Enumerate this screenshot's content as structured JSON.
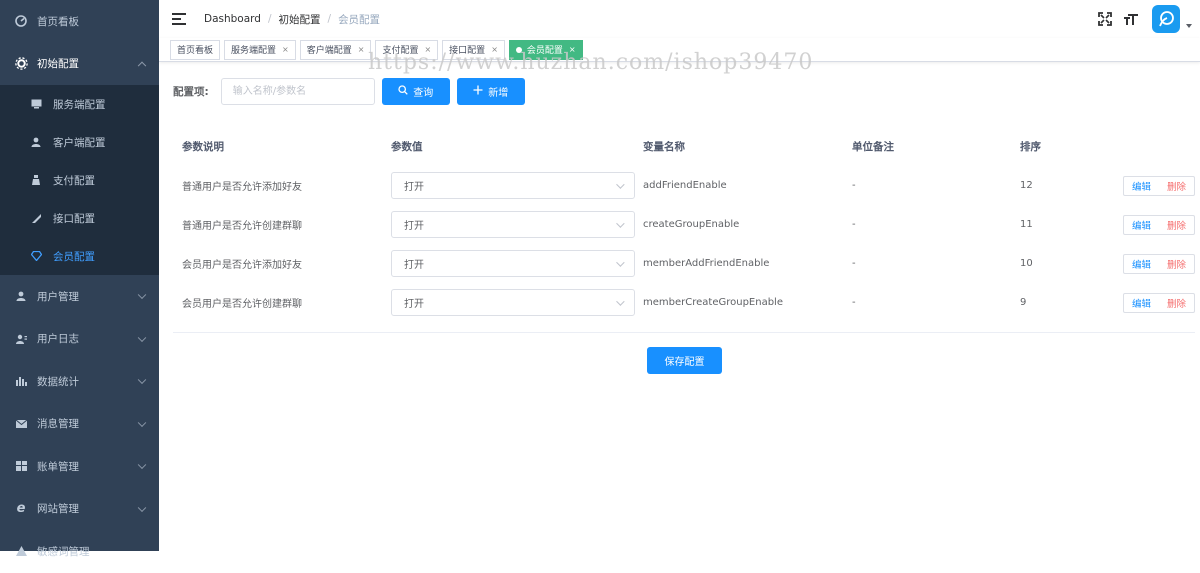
{
  "sidebar": {
    "items": [
      {
        "label": "首页看板",
        "icon": "dashboard-icon"
      },
      {
        "label": "初始配置",
        "icon": "settings-icon",
        "open": true,
        "children": [
          {
            "label": "服务端配置",
            "icon": "monitor-icon"
          },
          {
            "label": "客户端配置",
            "icon": "user-icon"
          },
          {
            "label": "支付配置",
            "icon": "payment-icon"
          },
          {
            "label": "接口配置",
            "icon": "plug-icon"
          },
          {
            "label": "会员配置",
            "icon": "diamond-icon",
            "active": true
          }
        ]
      },
      {
        "label": "用户管理",
        "icon": "user-icon"
      },
      {
        "label": "用户日志",
        "icon": "users-log-icon"
      },
      {
        "label": "数据统计",
        "icon": "bar-chart-icon"
      },
      {
        "label": "消息管理",
        "icon": "mail-icon"
      },
      {
        "label": "账单管理",
        "icon": "bill-icon"
      },
      {
        "label": "网站管理",
        "icon": "ie-icon"
      },
      {
        "label": "敏感词管理",
        "icon": "warning-icon"
      }
    ]
  },
  "breadcrumb": [
    "Dashboard",
    "初始配置",
    "会员配置"
  ],
  "tags": [
    {
      "label": "首页看板",
      "closable": false
    },
    {
      "label": "服务端配置",
      "closable": true
    },
    {
      "label": "客户端配置",
      "closable": true
    },
    {
      "label": "支付配置",
      "closable": true
    },
    {
      "label": "接口配置",
      "closable": true
    },
    {
      "label": "会员配置",
      "closable": true,
      "active": true
    }
  ],
  "watermark": "https://www.huzhan.com/ishop39470",
  "search": {
    "label": "配置项:",
    "placeholder": "输入名称/参数名",
    "query_label": "查询",
    "add_label": "新增"
  },
  "table": {
    "headers": [
      "参数说明",
      "参数值",
      "变量名称",
      "单位备注",
      "排序"
    ],
    "rows": [
      {
        "desc": "普通用户是否允许添加好友",
        "value": "打开",
        "var": "addFriendEnable",
        "unit": "-",
        "sort": "12"
      },
      {
        "desc": "普通用户是否允许创建群聊",
        "value": "打开",
        "var": "createGroupEnable",
        "unit": "-",
        "sort": "11"
      },
      {
        "desc": "会员用户是否允许添加好友",
        "value": "打开",
        "var": "memberAddFriendEnable",
        "unit": "-",
        "sort": "10"
      },
      {
        "desc": "会员用户是否允许创建群聊",
        "value": "打开",
        "var": "memberCreateGroupEnable",
        "unit": "-",
        "sort": "9"
      }
    ],
    "edit_label": "编辑",
    "delete_label": "删除"
  },
  "save_label": "保存配置",
  "colors": {
    "sidebar_bg": "#304156",
    "submenu_bg": "#1f2d3d",
    "primary": "#1890ff",
    "active_tag": "#42b983",
    "danger": "#f56c6c"
  }
}
